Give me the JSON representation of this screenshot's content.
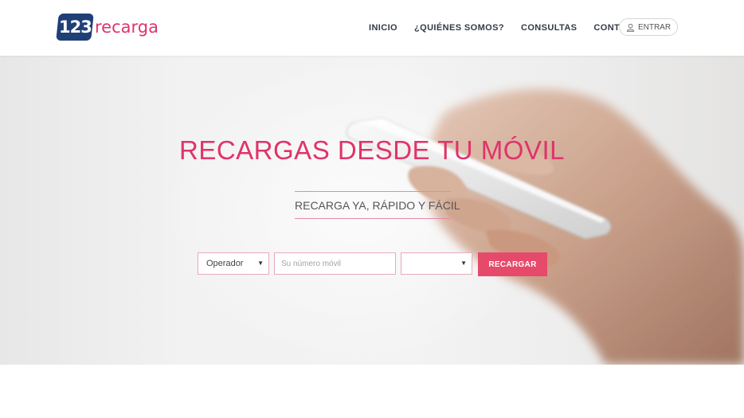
{
  "brand": {
    "logo_number": "123",
    "logo_text": "recarga",
    "colors": {
      "navy": "#1f3f77",
      "pink": "#e0336a",
      "button": "#e64a6b"
    }
  },
  "nav": {
    "items": [
      {
        "label": "INICIO"
      },
      {
        "label": "¿QUIÉNES SOMOS?"
      },
      {
        "label": "CONSULTAS"
      },
      {
        "label": "CONTACTO"
      }
    ],
    "login_label": "ENTRAR",
    "login_icon": "user-icon"
  },
  "hero": {
    "title": "RECARGAS DESDE TU MÓVIL",
    "subtitle": "RECARGA YA, RÁPIDO Y FÁCIL"
  },
  "form": {
    "operator_selected": "Operador",
    "phone_placeholder": "Su número móvil",
    "amount_selected": "",
    "submit_label": "RECARGAR",
    "caret_icon": "▼"
  }
}
